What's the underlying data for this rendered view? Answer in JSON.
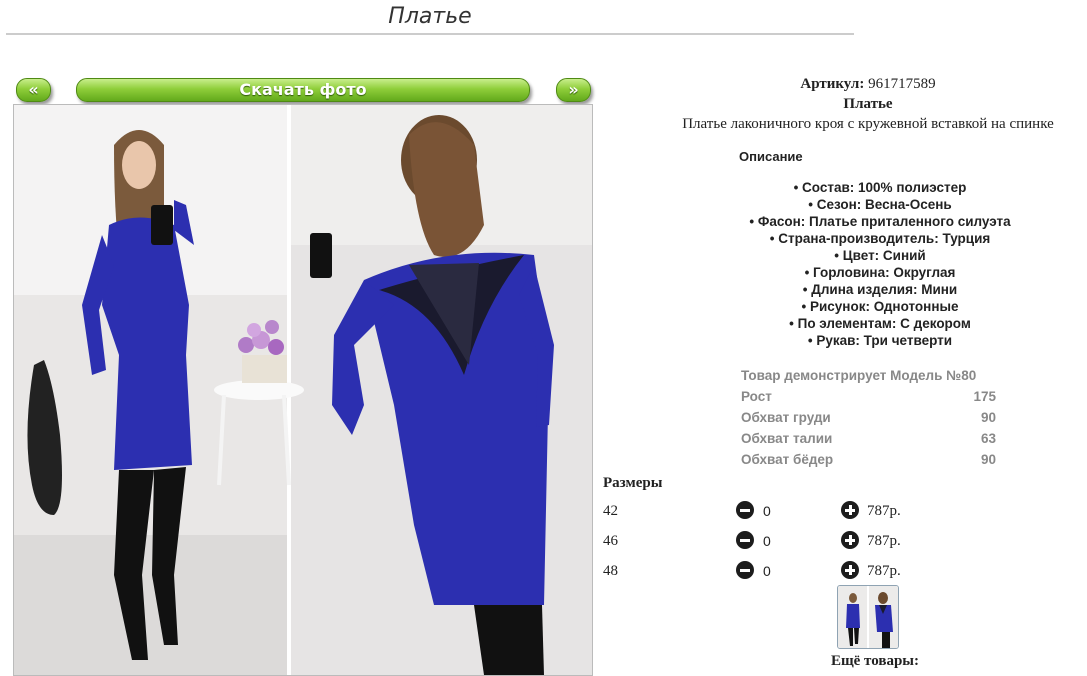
{
  "page": {
    "title": "Платье"
  },
  "gallery": {
    "prev_label": "«",
    "next_label": "»",
    "download_label": "Скачать фото"
  },
  "product": {
    "article_label": "Артикул:",
    "article_value": "961717589",
    "name": "Платье",
    "short_description": "Платье лаконичного кроя с кружевной вставкой на спинке",
    "description_heading": "Описание",
    "features": [
      "Состав: 100% полиэстер",
      "Сезон: Весна-Осень",
      "Фасон: Платье приталенного силуэта",
      "Страна-производитель: Турция",
      "Цвет: Синий",
      "Горловина: Округлая",
      "Длина изделия: Мини",
      "Рисунок: Однотонные",
      "По элементам: С декором",
      "Рукав: Три четверти"
    ]
  },
  "model": {
    "rows": [
      {
        "label": "Товар демонстрирует Модель №80",
        "value": ""
      },
      {
        "label": "Рост",
        "value": "175"
      },
      {
        "label": "Обхват груди",
        "value": "90"
      },
      {
        "label": "Обхват талии",
        "value": "63"
      },
      {
        "label": "Обхват бёдер",
        "value": "90"
      }
    ]
  },
  "sizes": {
    "heading": "Размеры",
    "rows": [
      {
        "size": "42",
        "qty": "0",
        "price": "787р."
      },
      {
        "size": "46",
        "qty": "0",
        "price": "787р."
      },
      {
        "size": "48",
        "qty": "0",
        "price": "787р."
      }
    ]
  },
  "more_products": {
    "label": "Ещё товары:"
  },
  "colors": {
    "button_green": "#7cc02b",
    "dress_blue": "#2c2fb0"
  }
}
